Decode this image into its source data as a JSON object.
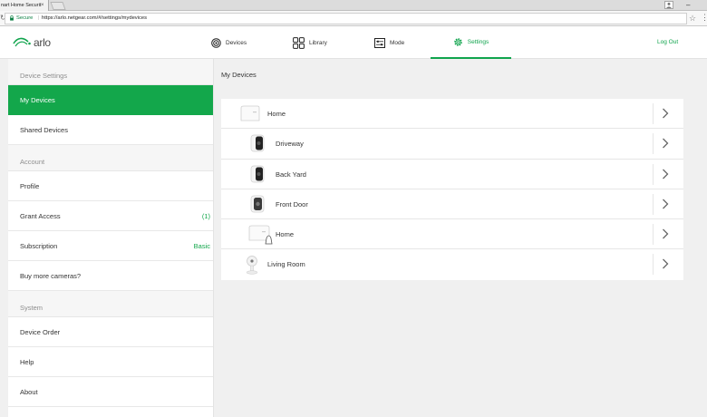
{
  "browser": {
    "tab_title": "nart Home Securit",
    "tab_close": "×",
    "secure_label": "Secure",
    "url": "https://arlo.netgear.com/#/settings/mydevices",
    "star": "☆",
    "menu": "⋮",
    "minimize": "–"
  },
  "header": {
    "logo": "arlo",
    "nav": [
      {
        "label": "Devices",
        "icon": "camera-lens-icon"
      },
      {
        "label": "Library",
        "icon": "grid-icon"
      },
      {
        "label": "Mode",
        "icon": "sliders-icon"
      },
      {
        "label": "Settings",
        "icon": "gear-icon",
        "active": true
      }
    ],
    "logout": "Log Out",
    "accent_color": "#10a44d"
  },
  "sidebar": {
    "sections": [
      {
        "title": "Device Settings",
        "items": [
          {
            "label": "My Devices",
            "active": true
          },
          {
            "label": "Shared Devices"
          }
        ]
      },
      {
        "title": "Account",
        "items": [
          {
            "label": "Profile"
          },
          {
            "label": "Grant Access",
            "value": "(1)"
          },
          {
            "label": "Subscription",
            "value": "Basic"
          },
          {
            "label": "Buy more cameras?"
          }
        ]
      },
      {
        "title": "System",
        "items": [
          {
            "label": "Device Order"
          },
          {
            "label": "Help"
          },
          {
            "label": "About"
          }
        ]
      }
    ]
  },
  "main": {
    "title": "My Devices",
    "devices": [
      {
        "name": "Home",
        "icon": "base-station-icon"
      },
      {
        "name": "Driveway",
        "icon": "camera-icon"
      },
      {
        "name": "Back Yard",
        "icon": "camera-icon"
      },
      {
        "name": "Front Door",
        "icon": "camera-icon"
      },
      {
        "name": "Home",
        "icon": "base-station-siren-icon"
      },
      {
        "name": "Living Room",
        "icon": "baby-camera-icon"
      }
    ]
  }
}
